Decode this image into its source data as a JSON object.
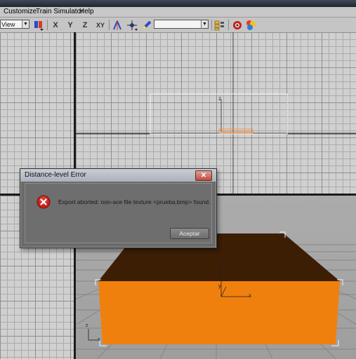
{
  "menubar": {
    "items": [
      "Customize",
      "Train Simulator",
      "Help"
    ]
  },
  "toolbar": {
    "view_combo": "View",
    "axis_x": "X",
    "axis_y": "Y",
    "axis_z": "Z",
    "axis_xy": "XY",
    "selection_set": ""
  },
  "viewports": {
    "axis_z": "z",
    "axis_y": "y",
    "axis_x": "x"
  },
  "dialog": {
    "title": "Distance-level Error",
    "close": "✕",
    "message": "Export aborted: non-ace file texture <prueba.bmp> found.",
    "ok_label": "Aceptar"
  },
  "colors": {
    "box_front": "#f0800e",
    "box_top": "#3c1e05",
    "error_red": "#c8201c",
    "selection_orange": "#ff8a2a"
  }
}
